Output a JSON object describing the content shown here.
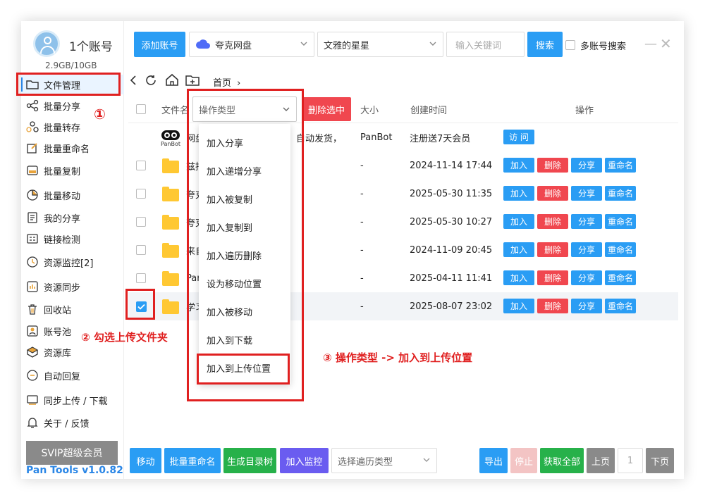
{
  "account": {
    "count_label": "1个账号",
    "storage": "2.9GB/10GB"
  },
  "sidebar": {
    "items": [
      {
        "label": "文件管理",
        "icon": "folder-icon"
      },
      {
        "label": "批量分享",
        "icon": "share-icon"
      },
      {
        "label": "批量转存",
        "icon": "transfer-icon"
      },
      {
        "label": "批量重命名",
        "icon": "rename-icon"
      },
      {
        "label": "批量复制",
        "icon": "copy-icon"
      },
      {
        "label": "批量移动",
        "icon": "move-icon"
      },
      {
        "label": "我的分享",
        "icon": "my-share-icon"
      },
      {
        "label": "链接检测",
        "icon": "link-check-icon"
      },
      {
        "label": "资源监控[2]",
        "icon": "monitor-icon"
      },
      {
        "label": "资源同步",
        "icon": "sync-icon"
      },
      {
        "label": "回收站",
        "icon": "trash-icon"
      },
      {
        "label": "账号池",
        "icon": "account-pool-icon"
      },
      {
        "label": "资源库",
        "icon": "library-icon"
      },
      {
        "label": "自动回复",
        "icon": "auto-reply-icon"
      },
      {
        "label": "同步上传 / 下载",
        "icon": "upload-download-icon"
      },
      {
        "label": "关于 / 反馈",
        "icon": "bell-icon"
      }
    ],
    "svip": "SVIP超级会员",
    "version": "Pan Tools v1.0.82"
  },
  "toolbar": {
    "add_account": "添加账号",
    "drive": "夸克网盘",
    "account_name": "文雅的星星",
    "search_placeholder": "输入关键词",
    "search_button": "搜索",
    "multi_search": "多账号搜索"
  },
  "nav": {
    "breadcrumb": "首页"
  },
  "table": {
    "headers": {
      "name": "文件名",
      "size": "大小",
      "created": "创建时间",
      "actions": "操作"
    },
    "op_type_placeholder": "操作类型",
    "delete_selected": "删除选中",
    "first_row": {
      "name_left": "网盘",
      "name_right": "自动发货，",
      "size": "PanBot",
      "created": "注册送7天会员",
      "visit": "访 问",
      "logo": "PanBot"
    },
    "rows": [
      {
        "name": "兹括",
        "size": "-",
        "created": "2024-11-14 17:44"
      },
      {
        "name": "夸克",
        "size": "-",
        "created": "2025-05-30 11:35"
      },
      {
        "name": "夸克",
        "size": "-",
        "created": "2025-05-30 10:27"
      },
      {
        "name": "来自",
        "size": "-",
        "created": "2024-11-09 20:45"
      },
      {
        "name": "Pan",
        "size": "-",
        "created": "2025-04-11 11:41"
      },
      {
        "name": "学习",
        "size": "-",
        "created": "2025-08-07 23:02"
      }
    ],
    "action_labels": {
      "add": "加入",
      "delete": "删除",
      "share": "分享",
      "rename": "重命名"
    }
  },
  "op_menu": {
    "items": [
      "加入分享",
      "加入递增分享",
      "加入被复制",
      "加入复制到",
      "加入遍历删除",
      "设为移动位置",
      "加入被移动",
      "加入到下载",
      "加入到上传位置"
    ]
  },
  "annotations": {
    "step1": "①",
    "step2": "② 勾选上传文件夹",
    "step3": "③ 操作类型 -> 加入到上传位置"
  },
  "bottom": {
    "move": "移动",
    "batch_rename": "批量重命名",
    "gen_tree": "生成目录树",
    "add_monitor": "加入监控",
    "traverse_placeholder": "选择遍历类型",
    "export": "导出",
    "stop": "停止",
    "get_all": "获取全部",
    "prev": "上页",
    "page": "1",
    "next": "下页"
  },
  "colors": {
    "accent": "#2a9df4",
    "danger": "#f0474f",
    "monitor": "#6a5cf0",
    "green": "#27b14a",
    "annotation": "#e02020"
  }
}
